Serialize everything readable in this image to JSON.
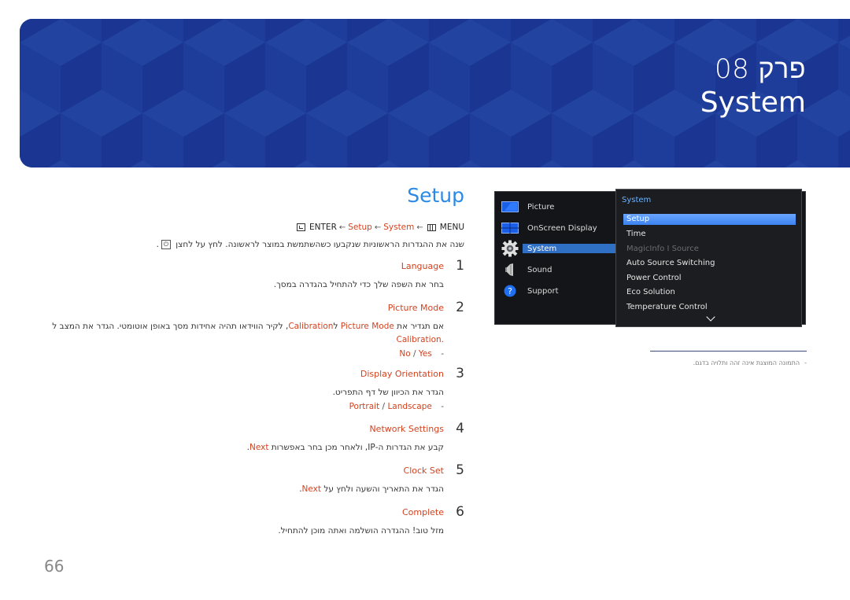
{
  "header": {
    "chapter": "פרק 08",
    "title": "System",
    "colors": {
      "banner": "#1e3d9a",
      "banner_light": "#2244a0",
      "banner_dark": "#1a3592"
    }
  },
  "section": {
    "title": "Setup",
    "path": {
      "enter": "ENTER",
      "setup": "Setup",
      "system": "System",
      "menu": "MENU",
      "arrow": "←",
      "icons": {
        "enter": "enter-icon",
        "menu": "menu-icon"
      }
    },
    "intro": "שנה את ההגדרות הראשוניות שנקבעו כשהשתמשת במוצר לראשונה. לחץ על לחצן",
    "intro_end": ".",
    "power_icon": "⏻",
    "steps": [
      {
        "num": "1",
        "label": "Language",
        "desc": "בחר את השפה שלך כדי להתחיל בהגדרה במסך."
      },
      {
        "num": "2",
        "label": "Picture Mode",
        "desc_parts": [
          "אם תגדיר את ",
          "Picture Mode",
          " ל",
          "Calibration",
          ", לקיר הווידאו תהיה אחידות מסך באופן אוטומטי. הגדר את המצב ל"
        ],
        "desc_line2": "Calibration.",
        "options": [
          "No",
          "Yes"
        ]
      },
      {
        "num": "3",
        "label": "Display Orientation",
        "desc": "הגדר את הכיוון של דף התפריט.",
        "options": [
          "Portrait",
          "Landscape"
        ]
      },
      {
        "num": "4",
        "label": "Network Settings",
        "desc": "קבע את הגדרות ה-IP, ולאחר מכן בחר באפשרות ",
        "desc_link": "Next",
        "desc_end": "."
      },
      {
        "num": "5",
        "label": "Clock Set",
        "desc": "הגדר את התאריך והשעה ולחץ על ",
        "desc_link": "Next",
        "desc_end": "."
      },
      {
        "num": "6",
        "label": "Complete",
        "desc": "מזל טוב! ההגדרה הושלמה ואתה מוכן להתחיל."
      }
    ],
    "option_separator": "/",
    "option_dash": "-"
  },
  "osd": {
    "left_menu": [
      {
        "label": "Picture",
        "icon": "picture-icon"
      },
      {
        "label": "OnScreen Display",
        "icon": "onscreen-display-icon"
      },
      {
        "label": "System",
        "icon": "gear-icon",
        "selected": true
      },
      {
        "label": "Sound",
        "icon": "speaker-icon"
      },
      {
        "label": "Support",
        "icon": "help-icon"
      }
    ],
    "submenu": {
      "heading": "System",
      "items": [
        {
          "label": "Setup",
          "state": "selected"
        },
        {
          "label": "Time",
          "state": "normal"
        },
        {
          "label": "MagicInfo I Source",
          "state": "disabled"
        },
        {
          "label": "Auto Source Switching",
          "state": "normal"
        },
        {
          "label": "Power Control",
          "state": "normal"
        },
        {
          "label": "Eco Solution",
          "state": "normal"
        },
        {
          "label": "Temperature Control",
          "state": "normal"
        }
      ],
      "more_icon": "chevron-down-icon"
    },
    "note": "התמונה המוצגת אינה זהה ותלויה בדגם.",
    "note_dash": "-"
  },
  "footer": {
    "page_number": "66"
  },
  "colors": {
    "accent_red": "#d2421f",
    "accent_blue": "#2a8ae6",
    "osd_select": "#3b83f0"
  }
}
